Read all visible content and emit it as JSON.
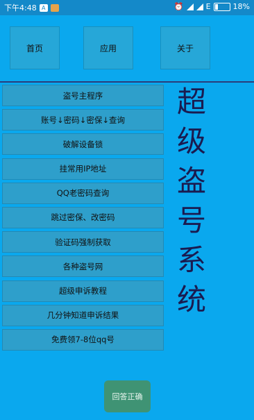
{
  "statusbar": {
    "time": "下午4:48",
    "left_icons": [
      "notification-icon",
      "app-icon"
    ],
    "network": "E",
    "battery": "18%",
    "battery_level": 0.18
  },
  "nav": {
    "home": "首页",
    "apps": "应用",
    "about": "关于"
  },
  "menu": {
    "items": [
      "盗号主程序",
      "账号↓密码↓密保↓查询",
      "破解设备锁",
      "挂常用IP地址",
      "QQ老密码查询",
      "跳过密保、改密码",
      "验证码强制获取",
      "各种盗号网",
      "超级申诉教程",
      "几分钟知道申诉结果",
      "免费领7-8位qq号"
    ]
  },
  "title_chars": [
    "超",
    "级",
    "盗",
    "号",
    "系",
    "统"
  ],
  "answer_button": "回答正确",
  "colors": {
    "background": "#0aa8ee",
    "title": "#1a1b50",
    "answer_button": "#3f9374"
  }
}
